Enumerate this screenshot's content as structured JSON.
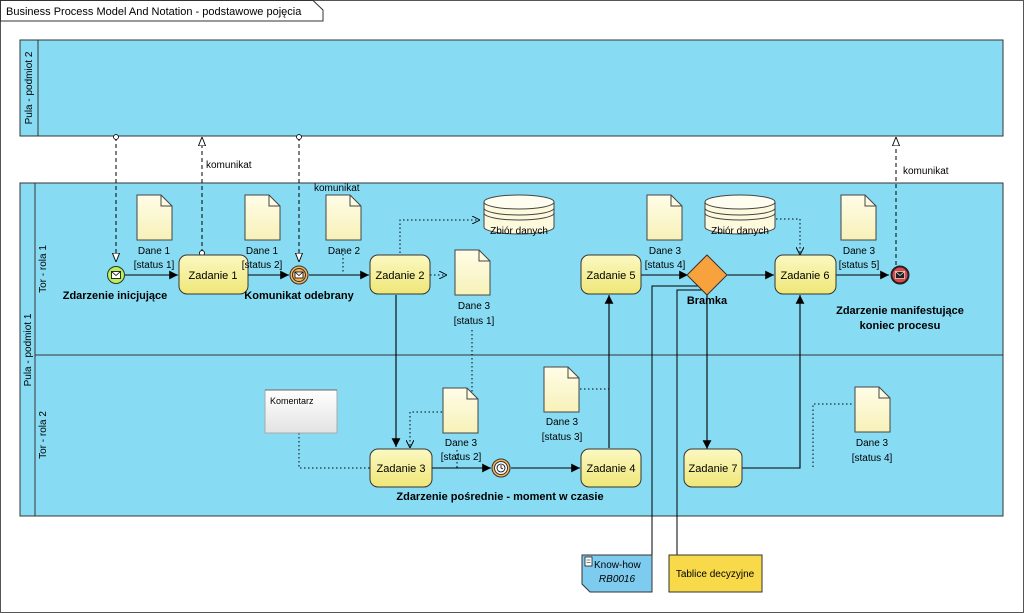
{
  "frame_title": "Business Process Model And Notation - podstawowe pojęcia",
  "pools": {
    "pool2_label": "Pula - podmiot 2",
    "pool1_label": "Pula - podmiot 1",
    "lane1_label": "Tor - rola 1",
    "lane2_label": "Tor - rola 2"
  },
  "events": {
    "start_label": "Zdarzenie inicjujące",
    "message_received_label": "Komunikat odebrany",
    "timer_label": "Zdarzenie pośrednie - moment w czasie",
    "end_label_line1": "Zdarzenie manifestujące",
    "end_label_line2": "koniec procesu"
  },
  "tasks": {
    "t1": "Zadanie 1",
    "t2": "Zadanie 2",
    "t3": "Zadanie 3",
    "t4": "Zadanie 4",
    "t5": "Zadanie 5",
    "t6": "Zadanie 6",
    "t7": "Zadanie 7"
  },
  "gateway_label": "Bramka",
  "data_objects": {
    "d1_name": "Dane 1",
    "d1_state": "[status 1]",
    "d1b_name": "Dane 1",
    "d1b_state": "[status 2]",
    "d2_name": "Dane 2",
    "d3a_name": "Dane 3",
    "d3a_state": "[status 1]",
    "d3b_name": "Dane 3",
    "d3b_state": "[status 2]",
    "d3c_name": "Dane 3",
    "d3c_state": "[status 3]",
    "d3d_name": "Dane 3",
    "d3d_state": "[status 4]",
    "d3e_name": "Dane 3",
    "d3e_state": "[status 4]",
    "d3f_name": "Dane 3",
    "d3f_state": "[status 5]"
  },
  "data_stores": {
    "s1": "Zbiór danych",
    "s2": "Zbiór danych"
  },
  "messages": {
    "m1": "komunikat",
    "m2": "komunikat",
    "m3": "komunikat"
  },
  "annotations": {
    "comment": "Komentarz",
    "knowhow_line1": "Know-how",
    "knowhow_line2": "RB0016",
    "decision_tables": "Tablice decyzyjne"
  },
  "colors": {
    "pool_fill": "#87dcf4",
    "task_fill": "#f7f29a",
    "gateway_fill": "#f7a23c",
    "start_fill": "#b6f05a",
    "end_fill": "#e04848",
    "knowhow_fill": "#7ecbf0",
    "decision_fill": "#f7d94a"
  }
}
